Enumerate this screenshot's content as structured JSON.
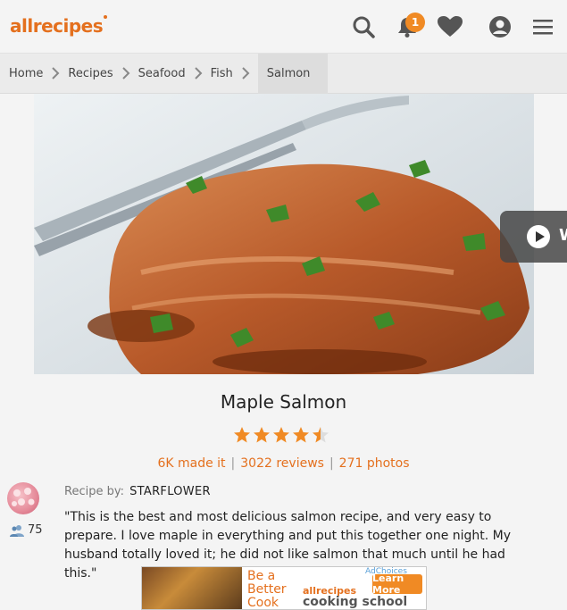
{
  "header": {
    "logo": "allrecipes",
    "notification_count": "1",
    "icons": [
      "search-icon",
      "bell-icon",
      "heart-icon",
      "user-icon",
      "menu-icon"
    ]
  },
  "breadcrumb": [
    "Home",
    "Recipes",
    "Seafood",
    "Fish",
    "Salmon"
  ],
  "video": {
    "label": "W"
  },
  "recipe": {
    "title": "Maple Salmon",
    "rating": 4.5,
    "made_it": "6K made it",
    "reviews": "3022 reviews",
    "photos": "271 photos",
    "recipe_by_label": "Recipe by:",
    "author": "STARFLOWER",
    "followers": "75",
    "description": "\"This is the best and most delicious salmon recipe, and very easy to prepare. I love maple in everything and put this together one night. My husband totally loved it; he did not like salmon that much until he had this.\""
  },
  "ad": {
    "line1": "Be a",
    "line2": "Better",
    "line3": "Cook",
    "brand": "allrecipes",
    "cooking_school": "cooking school",
    "learn_more": "Learn More",
    "adchoices": "AdChoices"
  },
  "colors": {
    "brand_orange": "#e4701e",
    "star": "#f08a24",
    "badge": "#f08a24"
  }
}
